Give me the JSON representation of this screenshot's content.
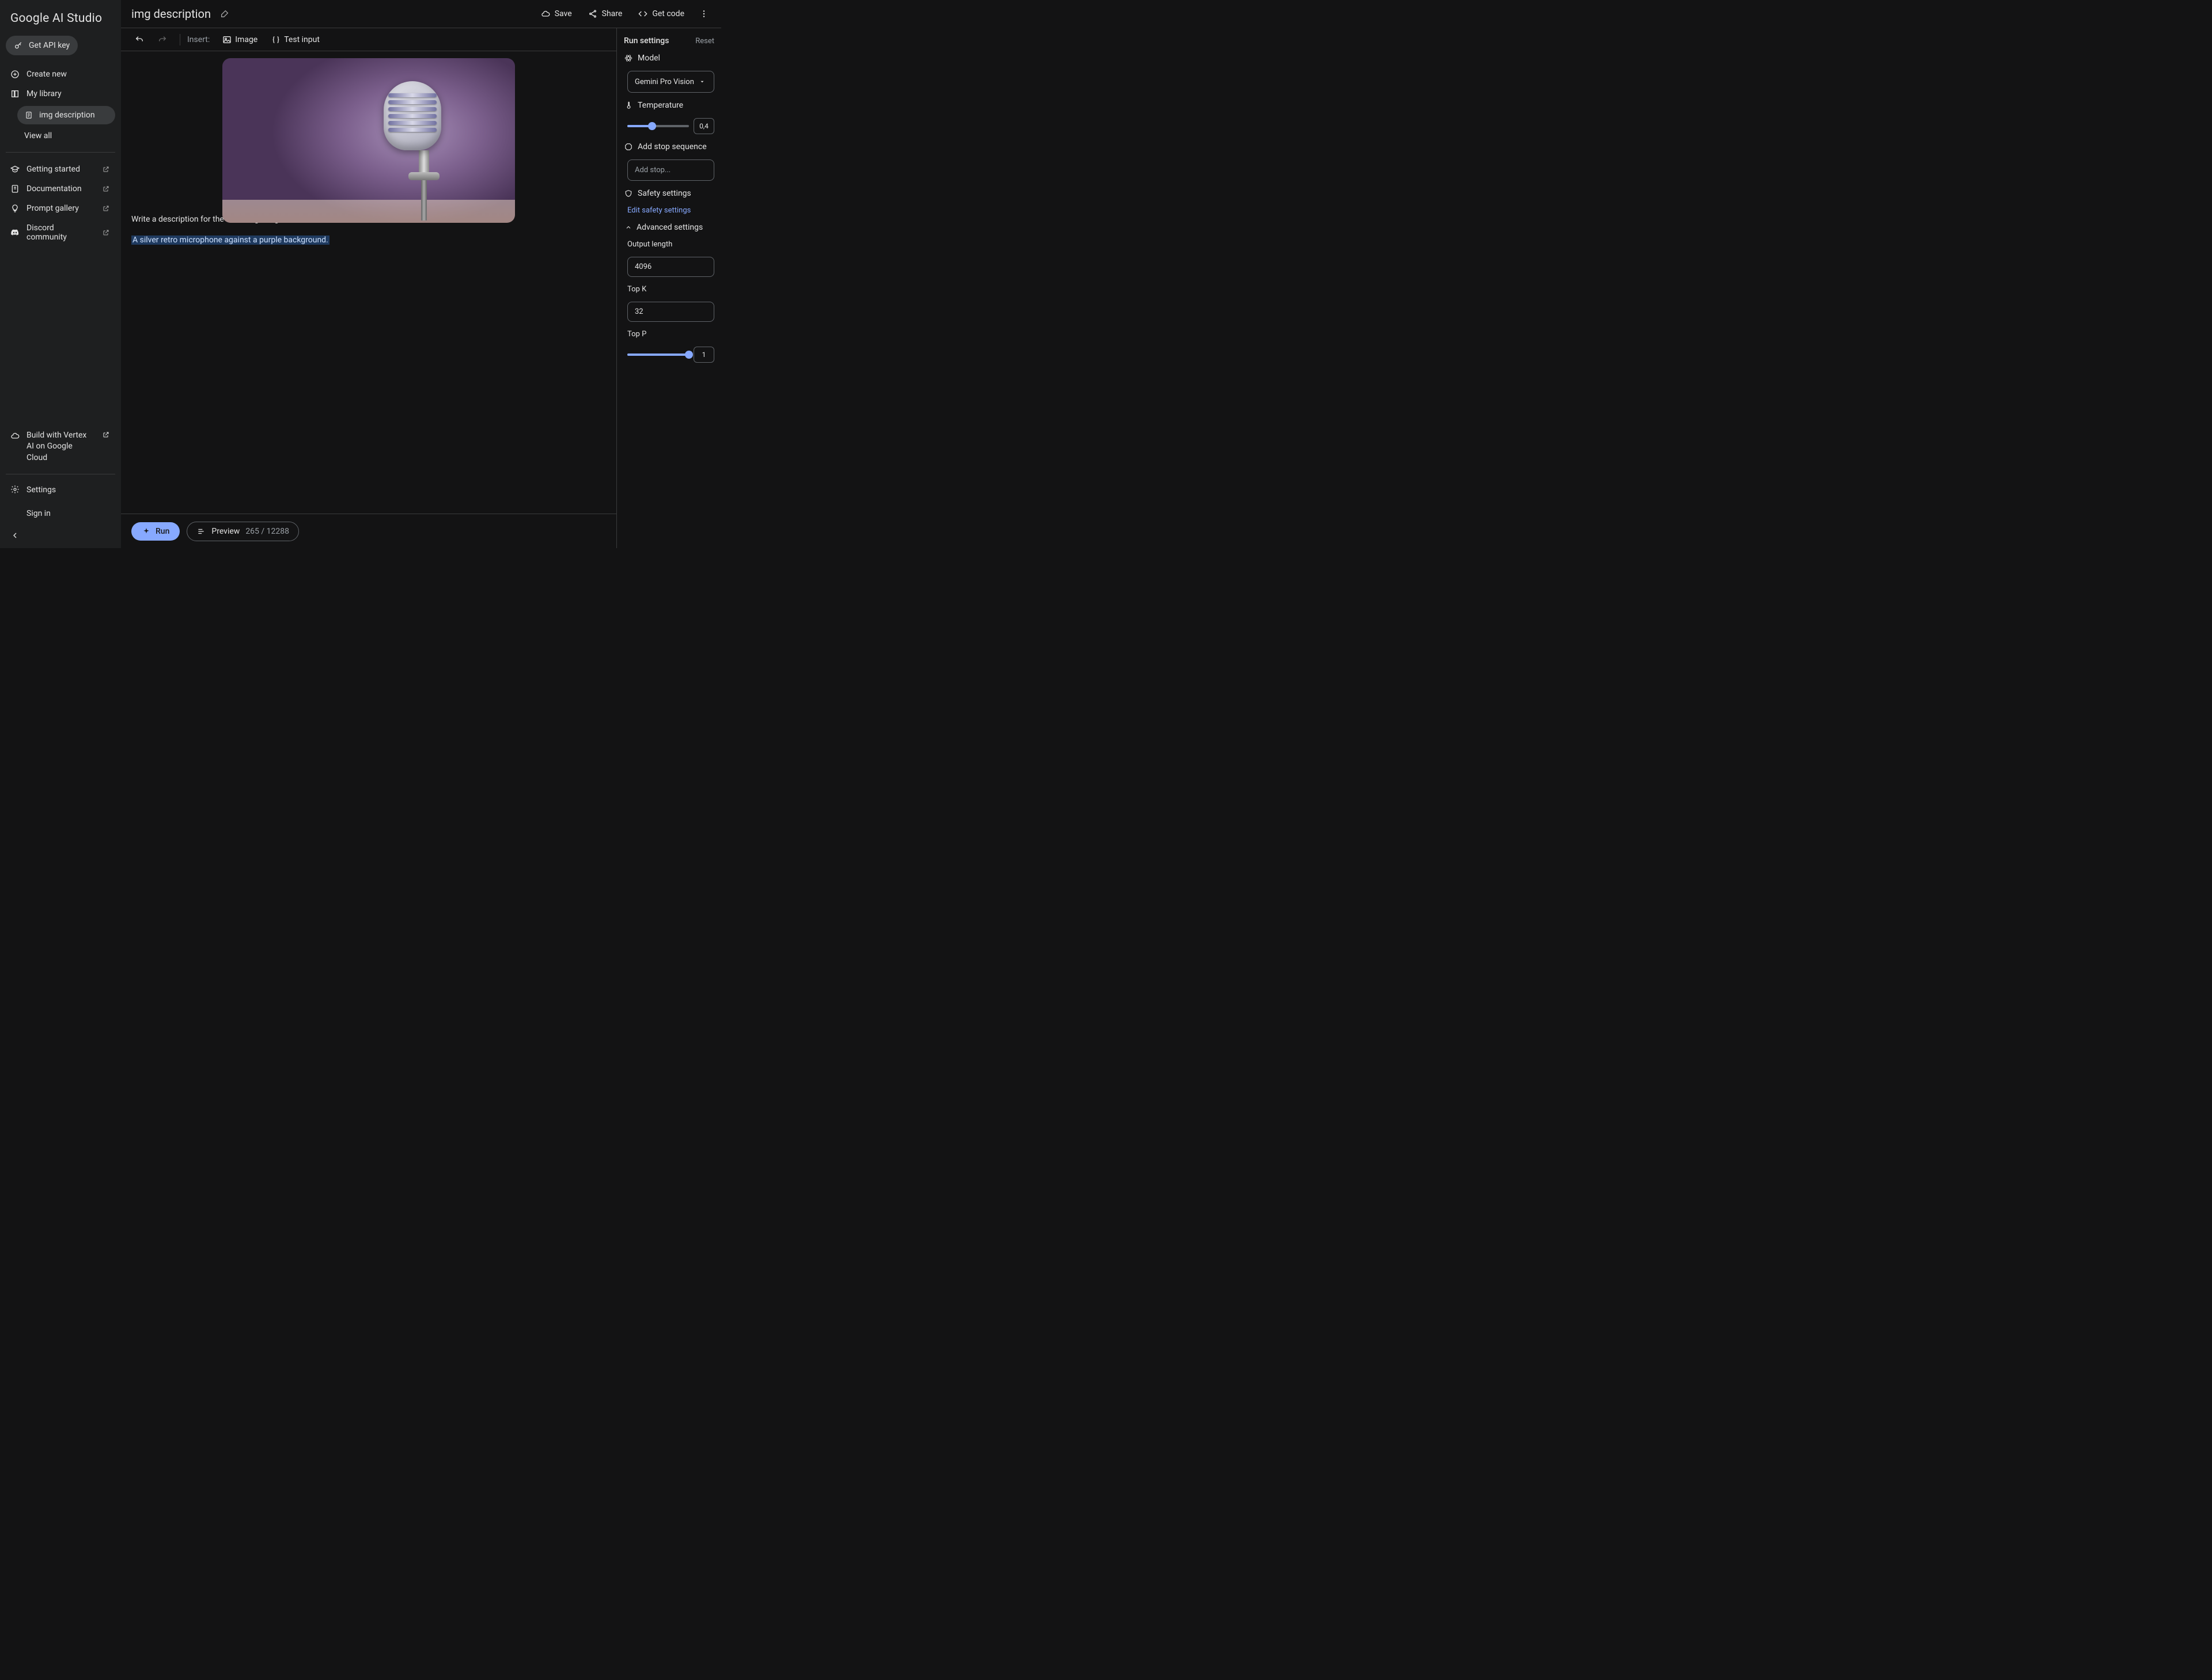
{
  "app_title": "Google AI Studio",
  "sidebar": {
    "api_key": "Get API key",
    "create_new": "Create new",
    "my_library": "My library",
    "library_item": "img description",
    "view_all": "View all",
    "links": {
      "getting_started": "Getting started",
      "documentation": "Documentation",
      "prompt_gallery": "Prompt gallery",
      "discord": "Discord community"
    },
    "vertex": "Build with Vertex AI on Google Cloud",
    "settings": "Settings",
    "sign_in": "Sign in"
  },
  "header": {
    "doc_title": "img description",
    "save": "Save",
    "share": "Share",
    "get_code": "Get code"
  },
  "toolbar": {
    "insert": "Insert:",
    "image": "Image",
    "test_input": "Test input"
  },
  "prompt": {
    "user_text": "Write a description for the following image",
    "generated": " A silver retro microphone against a purple background."
  },
  "footer": {
    "run": "Run",
    "preview": "Preview",
    "tokens": "265 / 12288"
  },
  "settings_panel": {
    "title": "Run settings",
    "reset": "Reset",
    "model_label": "Model",
    "model_value": "Gemini Pro Vision",
    "temperature_label": "Temperature",
    "temperature_value": "0,4",
    "temperature_pct": 40,
    "stop_label": "Add stop sequence",
    "stop_placeholder": "Add stop...",
    "safety_label": "Safety settings",
    "safety_link": "Edit safety settings",
    "advanced_label": "Advanced settings",
    "output_length_label": "Output length",
    "output_length_value": "4096",
    "topk_label": "Top K",
    "topk_value": "32",
    "topp_label": "Top P",
    "topp_value": "1",
    "topp_pct": 100
  }
}
